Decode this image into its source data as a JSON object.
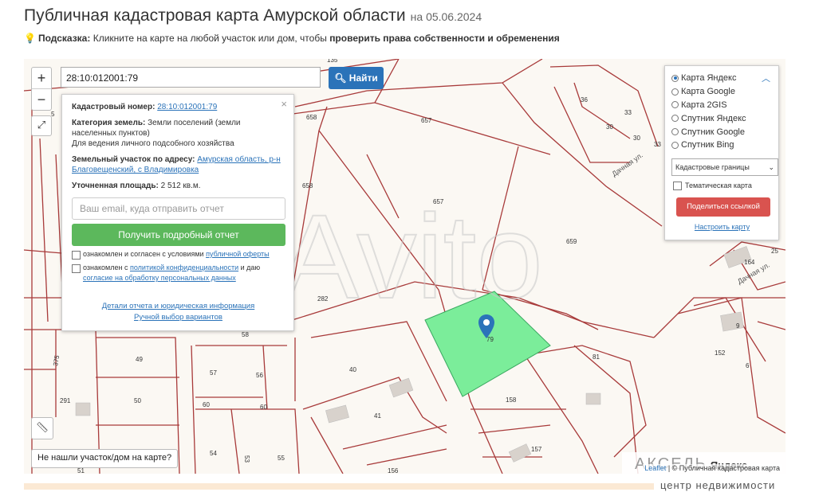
{
  "page": {
    "title": "Публичная кадастровая карта Амурской области",
    "date": "на 05.06.2024",
    "hint_label": "Подсказка:",
    "hint_text": "Кликните на карте на любой участок или дом, чтобы",
    "hint_bold": "проверить права собственности и обременения"
  },
  "search": {
    "value": "28:10:012001:79",
    "button_label": "Найти"
  },
  "zoom": {
    "plus": "+",
    "minus": "−"
  },
  "info_popup": {
    "close": "×",
    "cadastral_label": "Кадастровый номер:",
    "cadastral_value": "28:10:012001:79",
    "category_label": "Категория земель:",
    "category_value": "Земли поселений (земли населенных пунктов)",
    "usage": "Для ведения личного подсобного хозяйства",
    "address_label": "Земельный участок по адресу:",
    "address_value": "Амурская область, р-н Благовещенский, с Владимировка",
    "area_label": "Уточненная площадь:",
    "area_value": "2 512 кв.м.",
    "email_placeholder": "Ваш email, куда отправить отчет",
    "report_button": "Получить подробный отчет",
    "consent1_text": "ознакомлен и согласен с условиями",
    "consent1_link": "публичной оферты",
    "consent2_text": "ознакомлен с",
    "consent2_link1": "политикой конфиденциальности",
    "consent2_mid": "и даю",
    "consent2_link2": "согласие на обработку персональных данных",
    "details_link": "Детали отчета и юридическая информация",
    "manual_link": "Ручной выбор вариантов"
  },
  "layers": {
    "options": [
      {
        "label": "Карта Яндекс",
        "selected": true
      },
      {
        "label": "Карта Google",
        "selected": false
      },
      {
        "label": "Карта 2GIS",
        "selected": false
      },
      {
        "label": "Спутник Яндекс",
        "selected": false
      },
      {
        "label": "Спутник Google",
        "selected": false
      },
      {
        "label": "Спутник Bing",
        "selected": false
      }
    ],
    "select_value": "Кадастровые границы",
    "thematic_label": "Тематическая карта",
    "share_button": "Поделиться ссылкой",
    "settings_link": "Настроить карту"
  },
  "map": {
    "parcel_labels": [
      "5",
      "135",
      "658",
      "657",
      "36",
      "33",
      "30",
      "33",
      "30",
      "658",
      "657",
      "659",
      "164",
      "25",
      "282",
      "9",
      "152",
      "6",
      "49",
      "50",
      "291",
      "40",
      "41",
      "57",
      "56",
      "58",
      "60",
      "60",
      "54",
      "55",
      "158",
      "157",
      "156",
      "81",
      "79",
      "375",
      "51",
      "53"
    ],
    "street_labels": [
      "Дачная ул.",
      "Дачная ул."
    ],
    "selected_parcel_color": "#7bed9a",
    "line_color": "#a83a3a",
    "watermark": "Avito"
  },
  "bottom": {
    "ruler_icon": "ruler-icon",
    "not_found_button": "Не нашли участок/дом на карте?",
    "brand": "АКСЕЛЬ",
    "yandex": "Яндекс",
    "attribution_leaflet": "Leaflet",
    "attribution_text": "| © Публичная кадастровая карта",
    "brand_sub": "центр недвижимости"
  }
}
